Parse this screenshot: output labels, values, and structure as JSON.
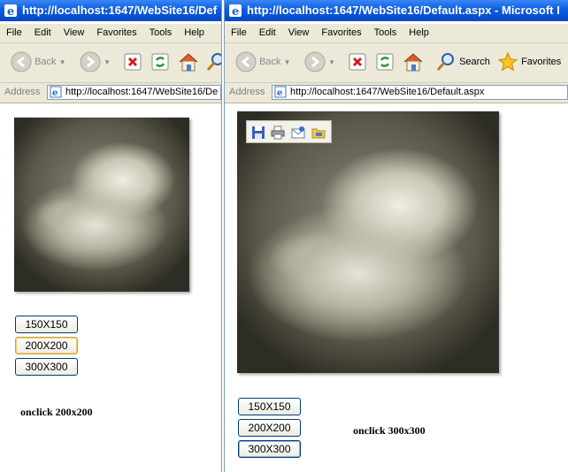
{
  "window_left": {
    "title": "http://localhost:1647/WebSite16/Def",
    "menu": [
      "File",
      "Edit",
      "View",
      "Favorites",
      "Tools",
      "Help"
    ],
    "toolbar": {
      "back_label": "Back"
    },
    "address": {
      "label": "Address",
      "url": "http://localhost:1647/WebSite16/De"
    },
    "buttons": [
      "150X150",
      "200X200",
      "300X300"
    ],
    "caption": "onclick 200x200"
  },
  "window_right": {
    "title": "http://localhost:1647/WebSite16/Default.aspx - Microsoft I",
    "menu": [
      "File",
      "Edit",
      "View",
      "Favorites",
      "Tools",
      "Help"
    ],
    "toolbar": {
      "back_label": "Back",
      "search_label": "Search",
      "favorites_label": "Favorites"
    },
    "address": {
      "label": "Address",
      "url": "http://localhost:1647/WebSite16/Default.aspx"
    },
    "buttons": [
      "150X150",
      "200X200",
      "300X300"
    ],
    "caption": "onclick 300x300"
  },
  "colors": {
    "titlebar": "#0c5ce2",
    "chrome": "#ece9d8",
    "button_border": "#003c74",
    "focus": "#f5cd60"
  }
}
